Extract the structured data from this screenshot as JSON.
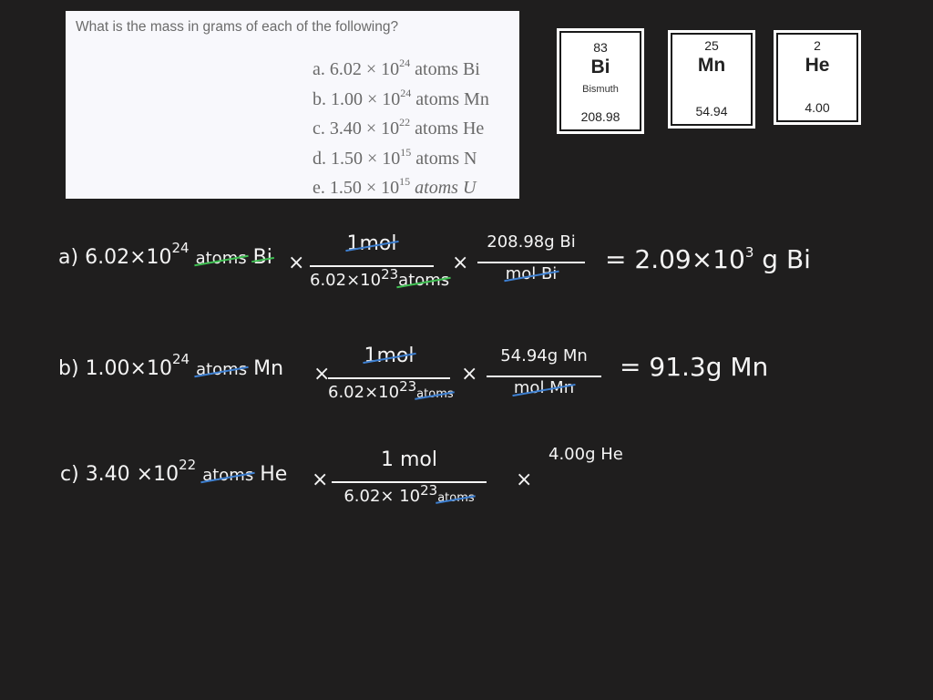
{
  "problem": {
    "question": "What is the mass in grams of each of the following?",
    "items": [
      {
        "letter": "a.",
        "coef": "6.02 × 10",
        "exp": "24",
        "unit": "atoms Bi"
      },
      {
        "letter": "b.",
        "coef": "1.00 × 10",
        "exp": "24",
        "unit": "atoms Mn"
      },
      {
        "letter": "c.",
        "coef": "3.40 × 10",
        "exp": "22",
        "unit": "atoms He"
      },
      {
        "letter": "d.",
        "coef": "1.50 × 10",
        "exp": "15",
        "unit": "atoms N"
      },
      {
        "letter": "e.",
        "coef": "1.50 × 10",
        "exp": "15",
        "unit": "atoms U"
      }
    ]
  },
  "elements": [
    {
      "number": "83",
      "symbol": "Bi",
      "name": "Bismuth",
      "mass": "208.98"
    },
    {
      "number": "25",
      "symbol": "Mn",
      "name": "",
      "mass": "54.94"
    },
    {
      "number": "2",
      "symbol": "He",
      "name": "",
      "mass": "4.00"
    }
  ],
  "work": {
    "a": {
      "label": "a)",
      "given": "6.02×10",
      "given_exp": "24",
      "given_unit1": "atoms",
      "given_unit2": "Bi",
      "times": "×",
      "f1_num": "1mol",
      "f1_den": "6.02×10",
      "f1_den_exp": "23",
      "f1_den_unit": "atoms",
      "f2_num": "208.98g Bi",
      "f2_den": "mol Bi",
      "equals": "=",
      "result": "2.09×10",
      "result_exp": "3",
      "result_unit": "g Bi"
    },
    "b": {
      "label": "b)",
      "given": "1.00×10",
      "given_exp": "24",
      "given_unit1": "atoms",
      "given_unit2": "Mn",
      "times": "×",
      "f1_num": "1mol",
      "f1_den": "6.02×10",
      "f1_den_exp": "23",
      "f1_den_unit": "atoms",
      "f2_num": "54.94g Mn",
      "f2_den": "mol Mn",
      "equals": "=",
      "result": "91.3g Mn"
    },
    "c": {
      "label": "c)",
      "given": "3.40 ×10",
      "given_exp": "22",
      "given_unit1": "atoms",
      "given_unit2": "He",
      "times": "×",
      "f1_num": "1 mol",
      "f1_den": "6.02× 10",
      "f1_den_exp": "23",
      "f1_den_unit": "atoms",
      "f2_num": "4.00g He"
    }
  },
  "colors": {
    "background": "#1f1e1e",
    "ink": "#f4f4f4",
    "green": "#3fbf52",
    "blue": "#3d7fd0"
  }
}
